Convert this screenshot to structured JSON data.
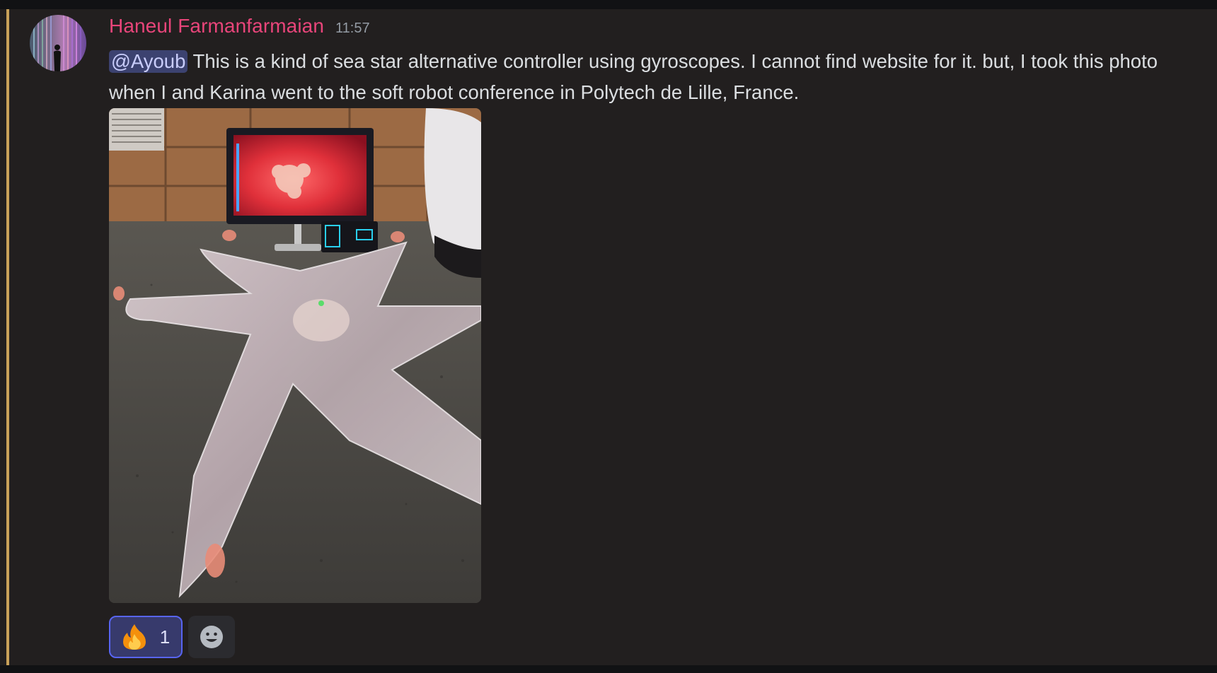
{
  "message": {
    "author": "Haneul Farmanfarmaian",
    "timestamp": "11:57",
    "mention": "@Ayoub",
    "text": " This is a kind of sea star alternative controller using gyroscopes. I cannot find website for it. but, I took this photo when I and Karina went to the soft robot conference in Polytech de Lille, France.",
    "avatar_icon": "user-avatar",
    "attachment_icon": "photo-sea-star-controller"
  },
  "reactions": [
    {
      "emoji_icon": "fire-icon",
      "count": "1",
      "active": true
    }
  ],
  "add_reaction_icon": "smiley-add-reaction-icon",
  "colors": {
    "username": "#e8457a",
    "mention_bar": "#c9a159",
    "mention_bg": "#3c4270",
    "reaction_active_border": "#5865f2"
  }
}
